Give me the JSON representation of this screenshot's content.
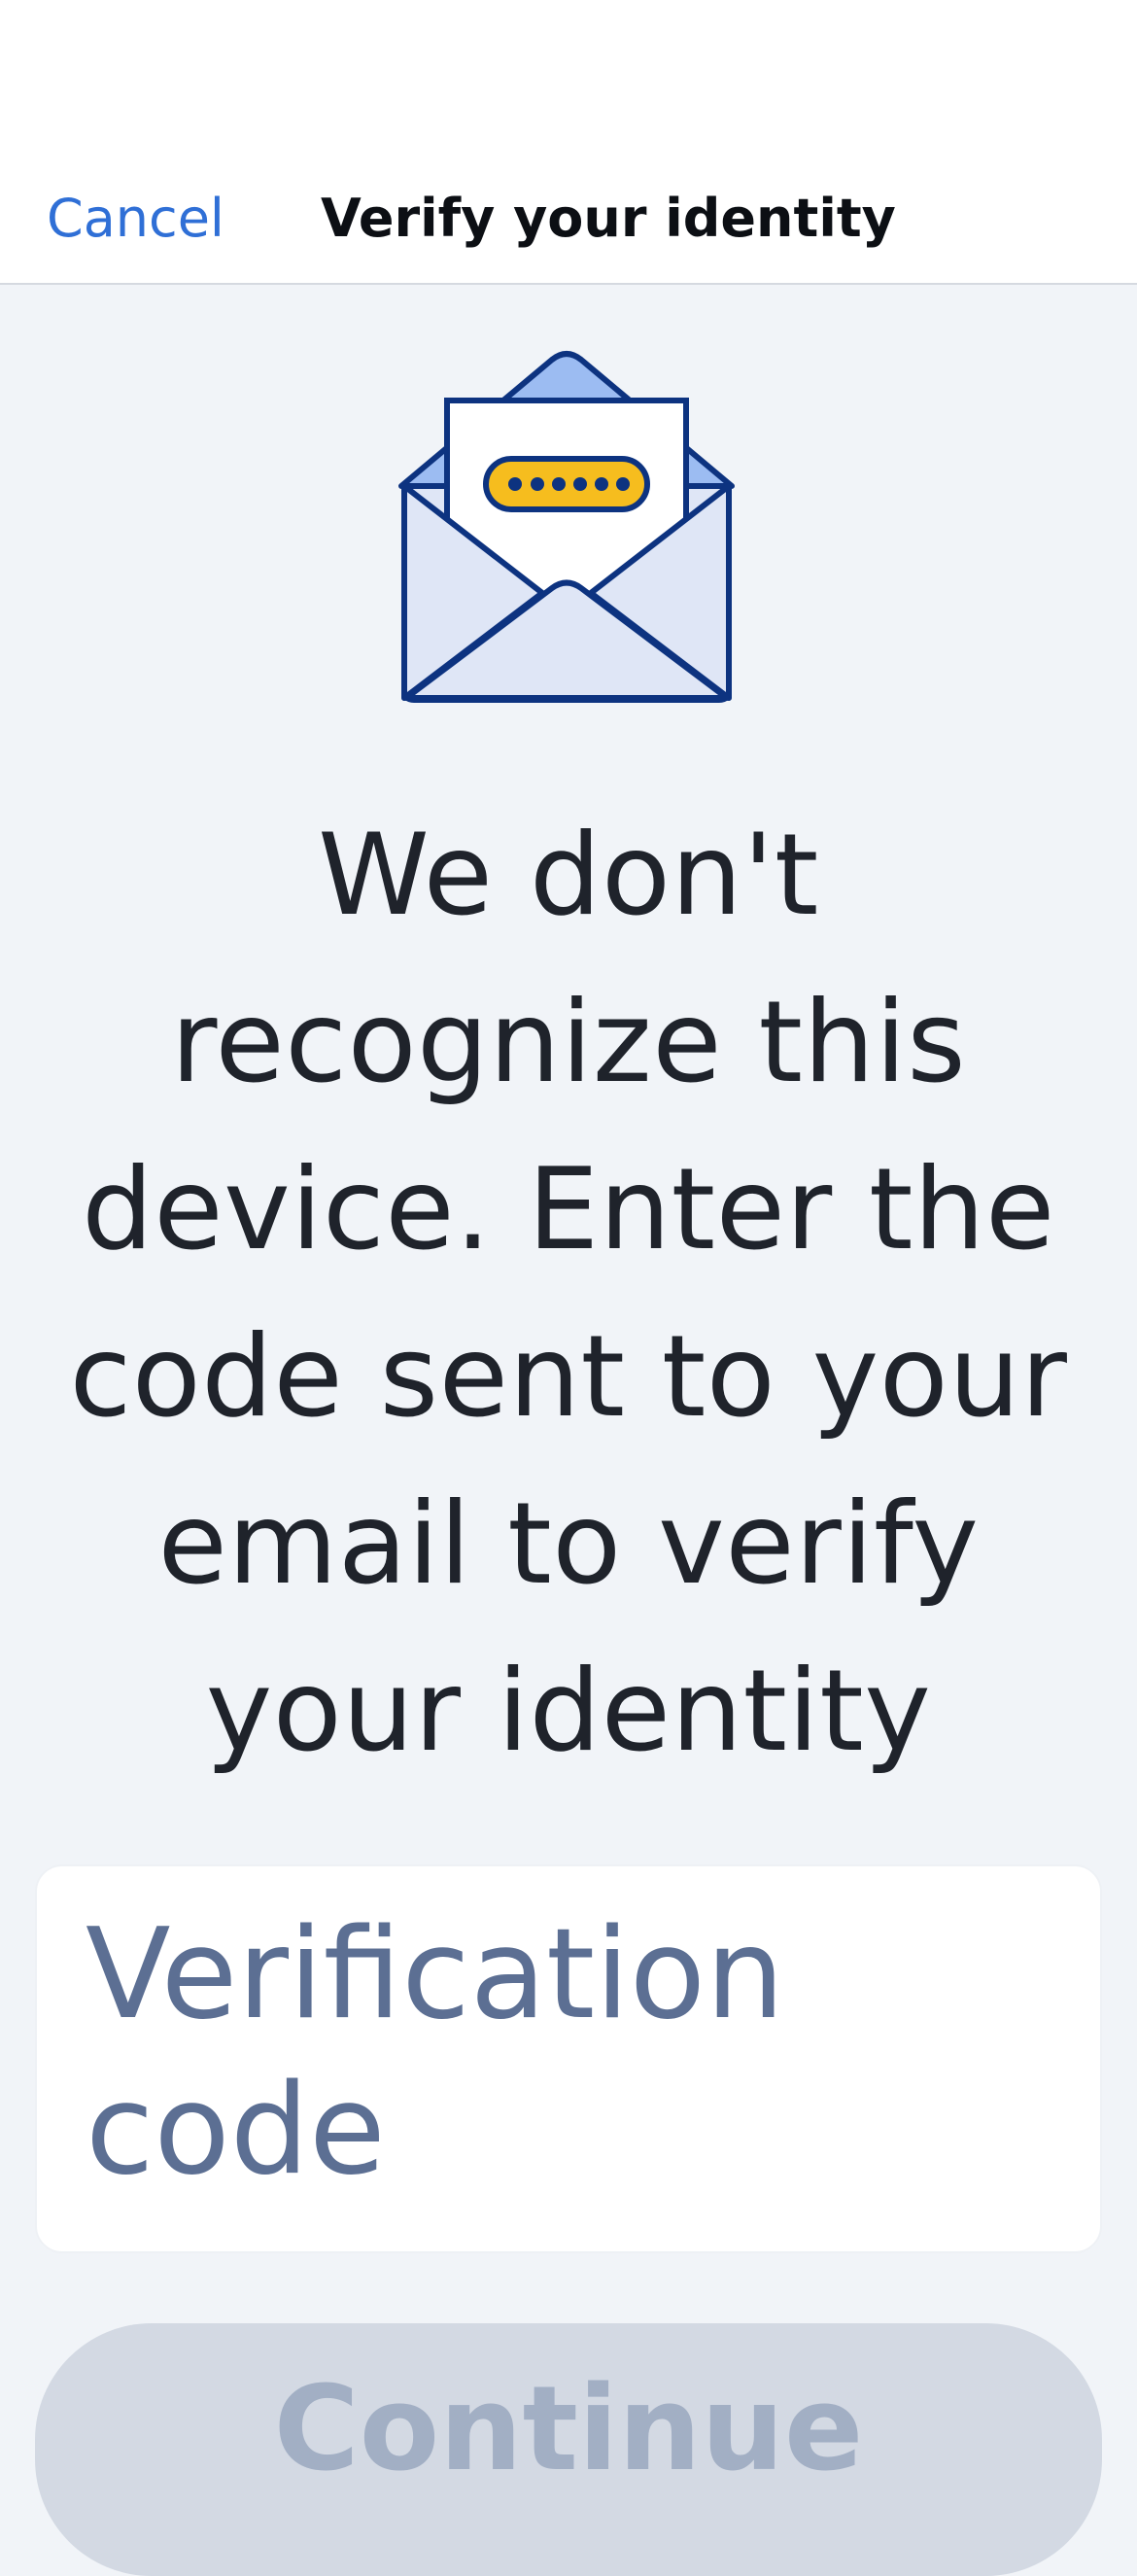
{
  "navbar": {
    "cancel_label": "Cancel",
    "title": "Verify your identity"
  },
  "illustration": {
    "icon": "envelope-with-code-icon",
    "colors": {
      "outline": "#0d3380",
      "envelope_fill": "#dfe6f6",
      "flap_fill": "#9cbcf2",
      "letter_fill": "#ffffff",
      "code_pill_fill": "#f6bd1e"
    }
  },
  "main": {
    "message": "We don't recognize this device. Enter the code sent to your email to verify your identity",
    "code_input": {
      "placeholder": "Verification code",
      "value": ""
    },
    "continue_label": "Continue"
  },
  "colors": {
    "accent": "#2f6fd6",
    "background": "#f1f4f8",
    "button_disabled": "#d3d9e3"
  }
}
